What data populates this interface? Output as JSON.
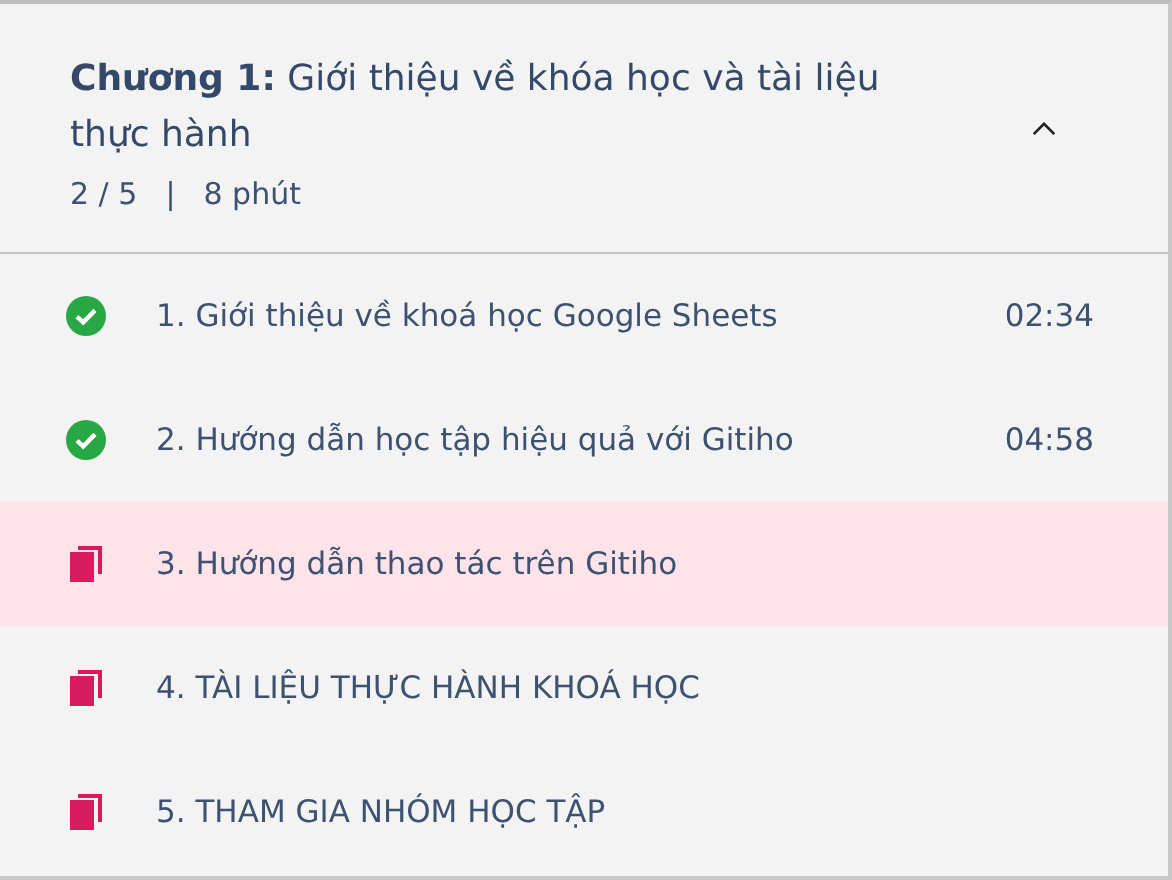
{
  "chapter": {
    "title": "**Chương 1:** Giới thiệu về khóa học và tài liệu thực hành",
    "progress": "2 / 5",
    "separator": "|",
    "duration": "8 phút",
    "expanded": true
  },
  "lessons": [
    {
      "kind": "done",
      "title": "1. Giới thiệu về khoá học Google Sheets",
      "duration": "02:34",
      "selected": false
    },
    {
      "kind": "done",
      "title": "2. Hướng dẫn học tập hiệu quả với Gitiho",
      "duration": "04:58",
      "selected": false
    },
    {
      "kind": "document",
      "title": "3. Hướng dẫn thao tác trên Gitiho",
      "selected": true
    },
    {
      "kind": "document",
      "title": "4. TÀI LIỆU THỰC HÀNH KHOÁ HỌC",
      "selected": false
    },
    {
      "kind": "document",
      "title": "5. THAM GIA NHÓM HỌC TẬP",
      "selected": false
    }
  ]
}
